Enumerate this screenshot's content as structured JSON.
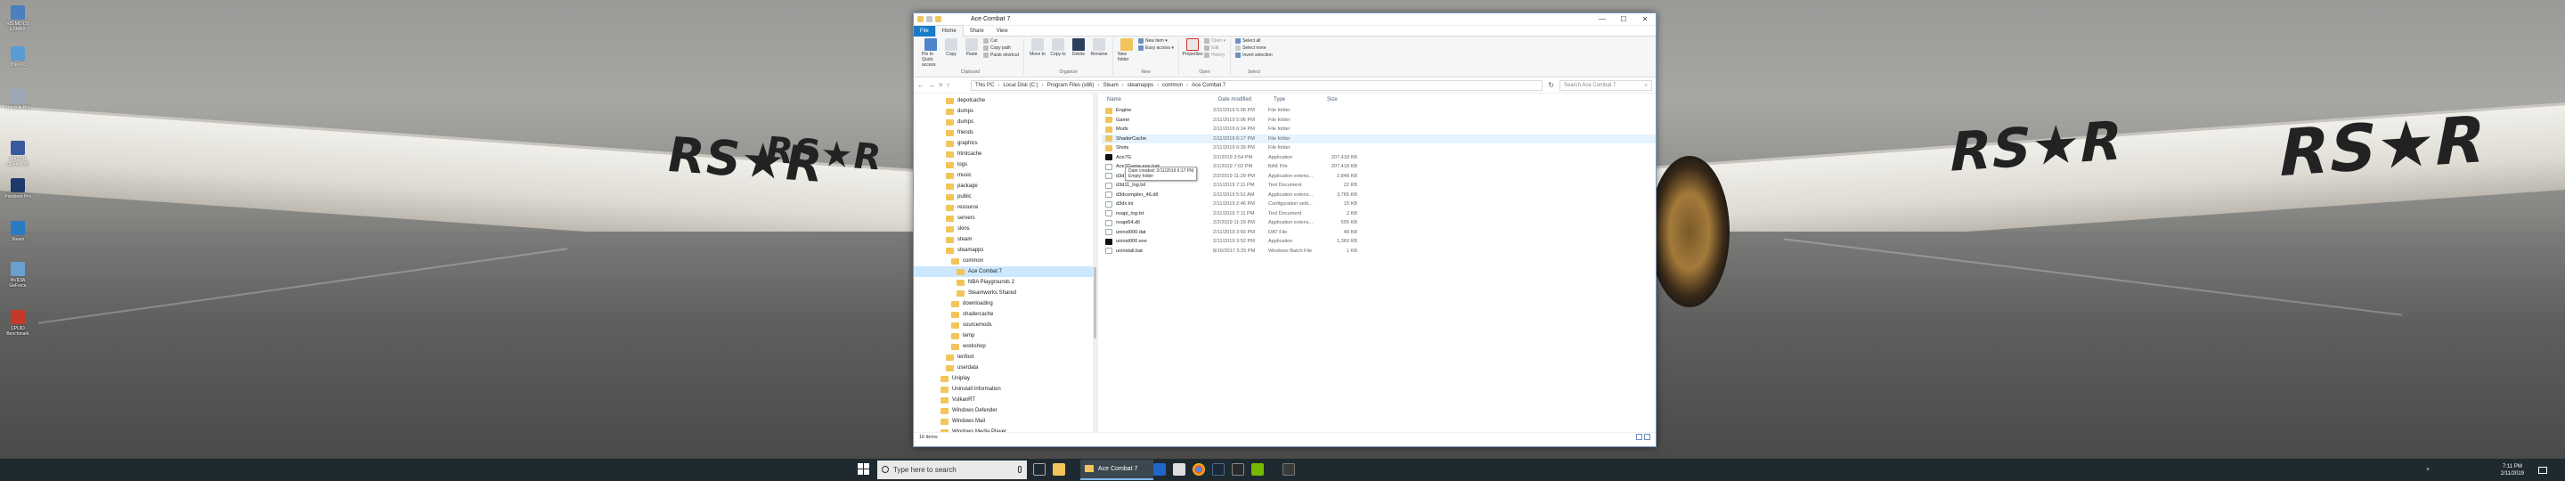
{
  "desktop": {
    "brand_logo": "RS★R",
    "icons": [
      {
        "label": "RIS MD DS ESMRX",
        "color": "#4a7fc0"
      },
      {
        "label": "This PC",
        "color": "#5a9bd5"
      },
      {
        "label": "Recycle Bin",
        "color": "#9aa8b8"
      },
      {
        "label": "MAXON Cinema 4D",
        "color": "#3a5aa0"
      },
      {
        "label": "Premiere Pro",
        "color": "#1d3a6a"
      },
      {
        "label": "Steam",
        "color": "#2a7bbf"
      },
      {
        "label": "NVIDIA GeForce",
        "color": "#6aa0d0"
      },
      {
        "label": "CPUID Benchmark",
        "color": "#c43a2a"
      }
    ]
  },
  "window": {
    "title": "Ace Combat 7",
    "controls": {
      "minimize": "—",
      "maximize": "☐",
      "close": "✕"
    },
    "ribbon_tabs": [
      "File",
      "Home",
      "Share",
      "View"
    ],
    "ribbon": {
      "clipboard": {
        "label": "Clipboard",
        "pin": "Pin to Quick access",
        "copy": "Copy",
        "paste": "Paste",
        "cut": "Cut",
        "copy_path": "Copy path",
        "paste_shortcut": "Paste shortcut"
      },
      "organize": {
        "label": "Organize",
        "move_to": "Move to",
        "copy_to": "Copy to",
        "delete": "Delete",
        "rename": "Rename"
      },
      "new": {
        "label": "New",
        "new_folder": "New folder",
        "new_item": "New item ▾",
        "easy_access": "Easy access ▾"
      },
      "open": {
        "label": "Open",
        "properties": "Properties",
        "open": "Open ▾",
        "edit": "Edit",
        "history": "History"
      },
      "select": {
        "label": "Select",
        "select_all": "Select all",
        "select_none": "Select none",
        "invert": "Invert selection"
      }
    },
    "address": {
      "back": "←",
      "forward": "→",
      "recent": "˅",
      "up": "↑",
      "crumbs": [
        "This PC",
        "Local Disk (C:)",
        "Program Files (x86)",
        "Steam",
        "steamapps",
        "common",
        "Ace Combat 7"
      ],
      "refresh": "↻"
    },
    "search": {
      "placeholder": "Search Ace Combat 7",
      "icon": "⌕"
    },
    "nav_tree": [
      {
        "label": "depotcache",
        "indent": 36
      },
      {
        "label": "dumps",
        "indent": 36
      },
      {
        "label": "dumps",
        "indent": 36
      },
      {
        "label": "friends",
        "indent": 36
      },
      {
        "label": "graphics",
        "indent": 36
      },
      {
        "label": "htmlcache",
        "indent": 36
      },
      {
        "label": "logs",
        "indent": 36
      },
      {
        "label": "music",
        "indent": 36
      },
      {
        "label": "package",
        "indent": 36
      },
      {
        "label": "public",
        "indent": 36
      },
      {
        "label": "resource",
        "indent": 36
      },
      {
        "label": "servers",
        "indent": 36
      },
      {
        "label": "skins",
        "indent": 36
      },
      {
        "label": "steam",
        "indent": 36
      },
      {
        "label": "steamapps",
        "indent": 36
      },
      {
        "label": "common",
        "indent": 42
      },
      {
        "label": "Ace Combat 7",
        "indent": 48,
        "selected": true
      },
      {
        "label": "NBA Playgrounds 2",
        "indent": 48
      },
      {
        "label": "Steamworks Shared",
        "indent": 48
      },
      {
        "label": "downloading",
        "indent": 42
      },
      {
        "label": "shadercache",
        "indent": 42
      },
      {
        "label": "sourcemods",
        "indent": 42
      },
      {
        "label": "temp",
        "indent": 42
      },
      {
        "label": "workshop",
        "indent": 42
      },
      {
        "label": "tenfoot",
        "indent": 36
      },
      {
        "label": "userdata",
        "indent": 36
      },
      {
        "label": "Uniplay",
        "indent": 30
      },
      {
        "label": "Uninstall Information",
        "indent": 30
      },
      {
        "label": "VulkanRT",
        "indent": 30
      },
      {
        "label": "Windows Defender",
        "indent": 30
      },
      {
        "label": "Windows Mail",
        "indent": 30
      },
      {
        "label": "Windows Media Player",
        "indent": 30
      }
    ],
    "columns": [
      "Name",
      "Date modified",
      "Type",
      "Size"
    ],
    "files": [
      {
        "name": "Engine",
        "date": "2/11/2019 5:06 PM",
        "type": "File folder",
        "size": "",
        "icon": "folder"
      },
      {
        "name": "Game",
        "date": "2/11/2019 5:06 PM",
        "type": "File folder",
        "size": "",
        "icon": "folder"
      },
      {
        "name": "Mods",
        "date": "2/11/2019 6:14 PM",
        "type": "File folder",
        "size": "",
        "icon": "folder"
      },
      {
        "name": "ShaderCache",
        "date": "2/11/2019 6:17 PM",
        "type": "File folder",
        "size": "",
        "icon": "folder",
        "hover": true
      },
      {
        "name": "Shots",
        "date": "2/11/2019 6:39 PM",
        "type": "File folder",
        "size": "",
        "icon": "folder"
      },
      {
        "name": "Ace7G",
        "date": "2/1/2019 3:54 PM",
        "type": "Application",
        "size": "207,418 KB",
        "icon": "dark"
      },
      {
        "name": "Ace7Game.exe.bak",
        "date": "2/1/2019 7:02 PM",
        "type": "BAK File",
        "size": "207,418 KB",
        "icon": "file"
      },
      {
        "name": "d3d11.dll",
        "date": "2/2/2019 11:29 PM",
        "type": "Application extens...",
        "size": "2,848 KB",
        "icon": "file"
      },
      {
        "name": "d3d11_log.txt",
        "date": "2/11/2019 7:11 PM",
        "type": "Text Document",
        "size": "22 KB",
        "icon": "file"
      },
      {
        "name": "d3dcompiler_46.dll",
        "date": "2/11/2019 5:51 AM",
        "type": "Application extens...",
        "size": "3,765 KB",
        "icon": "file"
      },
      {
        "name": "d3dx.ini",
        "date": "2/11/2019 2:46 PM",
        "type": "Configuration setti...",
        "size": "15 KB",
        "icon": "file"
      },
      {
        "name": "nvapi_log.txt",
        "date": "2/11/2019 7:11 PM",
        "type": "Text Document",
        "size": "2 KB",
        "icon": "file"
      },
      {
        "name": "nvapi64.dll",
        "date": "2/2/2019 11:29 PM",
        "type": "Application extens...",
        "size": "595 KB",
        "icon": "file"
      },
      {
        "name": "uninst000.dat",
        "date": "2/11/2019 3:56 PM",
        "type": "DAT File",
        "size": "48 KB",
        "icon": "file"
      },
      {
        "name": "uninst000.exe",
        "date": "2/11/2019 3:52 PM",
        "type": "Application",
        "size": "1,369 KB",
        "icon": "dark"
      },
      {
        "name": "uninstall.bat",
        "date": "8/16/2017 5:25 PM",
        "type": "Windows Batch File",
        "size": "1 KB",
        "icon": "file"
      }
    ],
    "tooltip": {
      "line1": "Date created: 2/11/2019 6:17 PM",
      "line2": "Empty folder"
    },
    "status": "16 items"
  },
  "taskbar": {
    "search_placeholder": "Type here to search",
    "active_app": "Ace Combat 7",
    "time": "7:11 PM",
    "date": "2/11/2019",
    "tray_arrow": "˄"
  },
  "colors": {
    "accent": "#1979ca",
    "folder": "#f2c55c",
    "selection": "#cce8ff",
    "taskbar": "#1f2a30"
  }
}
